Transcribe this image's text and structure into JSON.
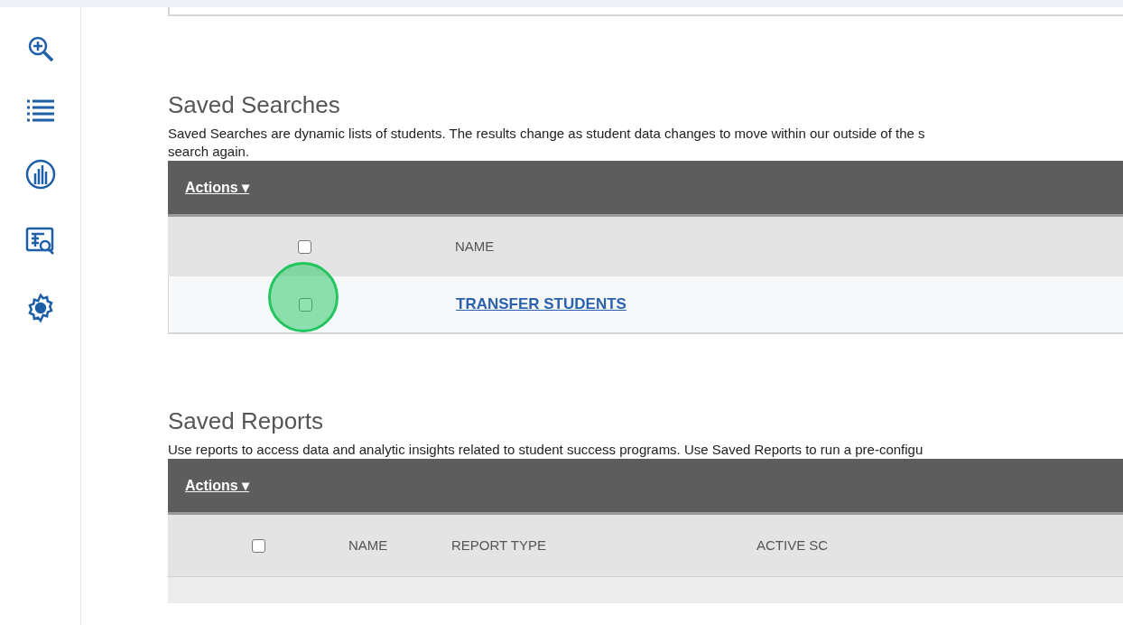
{
  "sidebar": {
    "items": [
      {
        "kind": "search"
      },
      {
        "kind": "list"
      },
      {
        "kind": "chart"
      },
      {
        "kind": "report"
      },
      {
        "kind": "settings"
      }
    ]
  },
  "saved_searches": {
    "title": "Saved Searches",
    "description_lines": [
      "Saved Searches are dynamic lists of students. The results change as student data changes to move within our outside of the s",
      "search again."
    ],
    "actions": "Actions ▾",
    "header": {
      "checked": false,
      "columns": [
        "NAME"
      ]
    },
    "rows": [
      {
        "checked": false,
        "highlighted": true,
        "name": "TRANSFER STUDENTS"
      }
    ]
  },
  "saved_reports": {
    "title": "Saved Reports",
    "description": "Use reports to access data and analytic insights related to student success programs. Use Saved Reports to run a pre-configu",
    "actions": "Actions ▾",
    "header": {
      "checked": false,
      "columns": [
        "NAME",
        "REPORT TYPE",
        "ACTIVE SC"
      ]
    }
  }
}
